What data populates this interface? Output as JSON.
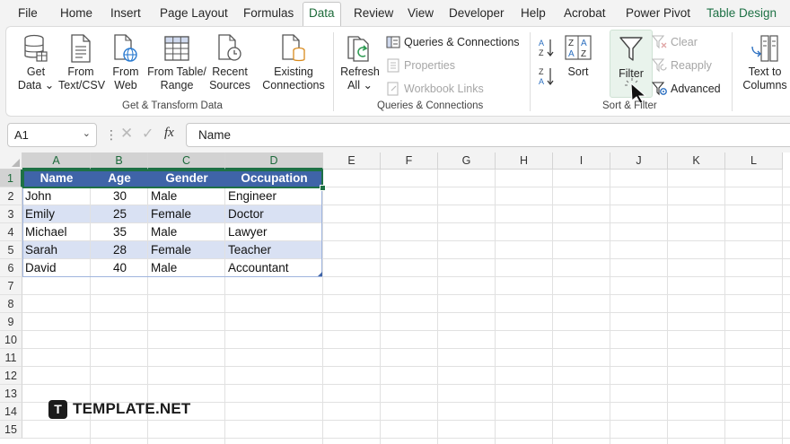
{
  "menu": {
    "tabs": [
      {
        "label": "File"
      },
      {
        "label": "Home"
      },
      {
        "label": "Insert"
      },
      {
        "label": "Page Layout"
      },
      {
        "label": "Formulas"
      },
      {
        "label": "Data"
      },
      {
        "label": "Review"
      },
      {
        "label": "View"
      },
      {
        "label": "Developer"
      },
      {
        "label": "Help"
      },
      {
        "label": "Acrobat"
      },
      {
        "label": "Power Pivot"
      },
      {
        "label": "Table Design"
      }
    ],
    "active": "Data"
  },
  "ribbon": {
    "get_transform": {
      "group_label": "Get & Transform Data",
      "get_data": {
        "line1": "Get",
        "line2": "Data ⌄"
      },
      "from_text_csv": {
        "line1": "From",
        "line2": "Text/CSV"
      },
      "from_web": {
        "line1": "From",
        "line2": "Web"
      },
      "from_table_range": {
        "line1": "From Table/",
        "line2": "Range"
      },
      "recent_sources": {
        "line1": "Recent",
        "line2": "Sources"
      },
      "existing_connections": {
        "line1": "Existing",
        "line2": "Connections"
      }
    },
    "queries": {
      "group_label": "Queries & Connections",
      "refresh_all": {
        "line1": "Refresh",
        "line2": "All ⌄"
      },
      "queries_connections": "Queries & Connections",
      "properties": "Properties",
      "workbook_links": "Workbook Links"
    },
    "sort_filter": {
      "group_label": "Sort & Filter",
      "sort": "Sort",
      "filter": "Filter",
      "clear": "Clear",
      "reapply": "Reapply",
      "advanced": "Advanced"
    },
    "data_tools": {
      "text_to_columns": {
        "line1": "Text to",
        "line2": "Columns"
      }
    }
  },
  "formula_bar": {
    "name_box": "A1",
    "fx": "fx",
    "value": "Name"
  },
  "grid": {
    "columns": [
      "A",
      "B",
      "C",
      "D",
      "E",
      "F",
      "G",
      "H",
      "I",
      "J",
      "K",
      "L"
    ],
    "rows": [
      "1",
      "2",
      "3",
      "4",
      "5",
      "6",
      "7",
      "8",
      "9",
      "10",
      "11",
      "12",
      "13",
      "14",
      "15"
    ],
    "table": {
      "headers": [
        "Name",
        "Age",
        "Gender",
        "Occupation"
      ],
      "rows": [
        [
          "John",
          "30",
          "Male",
          "Engineer"
        ],
        [
          "Emily",
          "25",
          "Female",
          "Doctor"
        ],
        [
          "Michael",
          "35",
          "Male",
          "Lawyer"
        ],
        [
          "Sarah",
          "28",
          "Female",
          "Teacher"
        ],
        [
          "David",
          "40",
          "Male",
          "Accountant"
        ]
      ],
      "header_color": "#3f64a8",
      "band_color": "#d9e1f3"
    }
  },
  "watermark": {
    "logo": "T",
    "text": "TEMPLATE.NET"
  },
  "colors": {
    "accent": "#1e7145"
  }
}
